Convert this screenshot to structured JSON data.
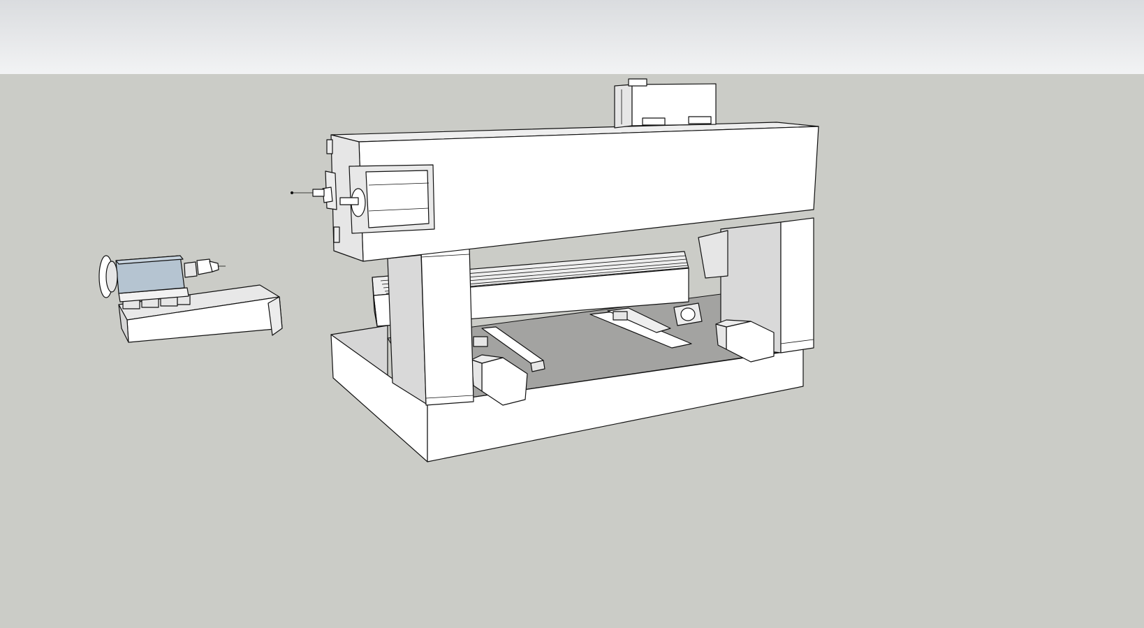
{
  "viewport": {
    "sky_color": "#e6e7e9",
    "ground_color": "#cbccc7"
  },
  "model": {
    "face_color": "#ffffff",
    "shade_color": "#dcdcdc",
    "shadow_color": "#a3a3a1",
    "motor_color": "#b5c4d1",
    "edge_color": "#111111"
  }
}
